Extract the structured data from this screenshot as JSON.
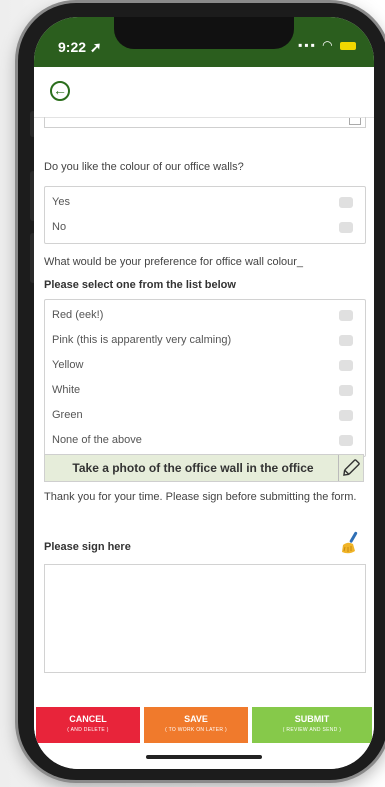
{
  "status": {
    "time": "9:22",
    "signal": "▪▪▪",
    "wifi": "◠"
  },
  "survey": {
    "q1": "Do you like the colour of our office walls?",
    "q1_options": [
      "Yes",
      "No"
    ],
    "q2": "What would be your preference for office wall colour_",
    "q2_hint": "Please select one from the list below",
    "q2_options": [
      "Red (eek!)",
      "Pink (this is apparently very calming)",
      "Yellow",
      "White",
      "Green",
      "None of the above"
    ],
    "photo_label": "Take a photo of the office wall in the office",
    "thanks": "Thank you for your time. Please sign before submitting the form.",
    "sign_label": "Please sign here"
  },
  "footer": {
    "cancel": "CANCEL",
    "cancel_sub": "( AND DELETE )",
    "save": "SAVE",
    "save_sub": "( TO WORK ON LATER )",
    "submit": "SUBMIT",
    "submit_sub": "( REVIEW AND SEND )"
  },
  "colors": {
    "header": "#2b5e1e",
    "cancel": "#e8243a",
    "save": "#f07a2c",
    "submit": "#86c94a"
  }
}
